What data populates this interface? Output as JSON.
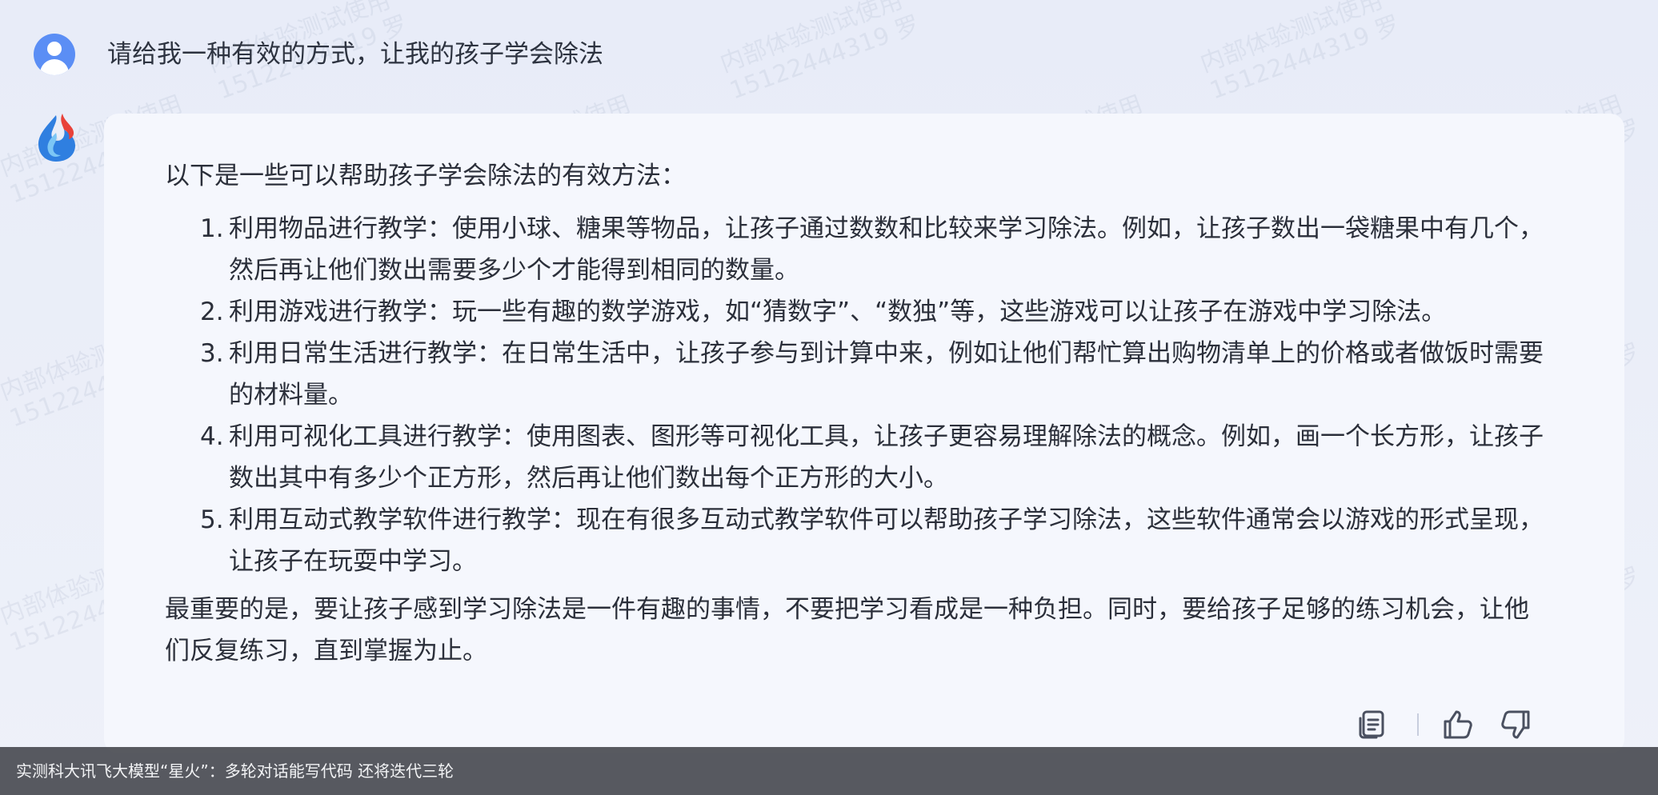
{
  "conversation": {
    "question": "请给我一种有效的方式，让我的孩子学会除法",
    "answer": {
      "intro": "以下是一些可以帮助孩子学会除法的有效方法：",
      "tips": [
        {
          "num": "1.",
          "text": "利用物品进行教学：使用小球、糖果等物品，让孩子通过数数和比较来学习除法。例如，让孩子数出一袋糖果中有几个，然后再让他们数出需要多少个才能得到相同的数量。"
        },
        {
          "num": "2.",
          "text": "利用游戏进行教学：玩一些有趣的数学游戏，如“猜数字”、“数独”等，这些游戏可以让孩子在游戏中学习除法。"
        },
        {
          "num": "3.",
          "text": "利用日常生活进行教学：在日常生活中，让孩子参与到计算中来，例如让他们帮忙算出购物清单上的价格或者做饭时需要的材料量。"
        },
        {
          "num": "4.",
          "text": "利用可视化工具进行教学：使用图表、图形等可视化工具，让孩子更容易理解除法的概念。例如，画一个长方形，让孩子数出其中有多少个正方形，然后再让他们数出每个正方形的大小。"
        },
        {
          "num": "5.",
          "text": "利用互动式教学软件进行教学：现在有很多互动式教学软件可以帮助孩子学习除法，这些软件通常会以游戏的形式呈现，让孩子在玩耍中学习。"
        }
      ],
      "conclusion": "最重要的是，要让孩子感到学习除法是一件有趣的事情，不要把学习看成是一种负担。同时，要给孩子足够的练习机会，让他们反复练习，直到掌握为止。"
    }
  },
  "actions": {
    "icons": [
      "copy-icon",
      "thumbs-up-icon",
      "thumbs-down-icon"
    ]
  },
  "watermark": {
    "line1": "内部体验测试使用",
    "line2": "15122444319 罗"
  },
  "caption": "实测科大讯飞大模型“星火”：多轮对话能写代码  还将迭代三轮",
  "colors": {
    "page_bg": "#e9edf7",
    "card_bg": "#f5f7fd",
    "user_avatar": "#5b8ef5",
    "text": "#2b2f3a",
    "caption_bar": "#4b4e54"
  }
}
